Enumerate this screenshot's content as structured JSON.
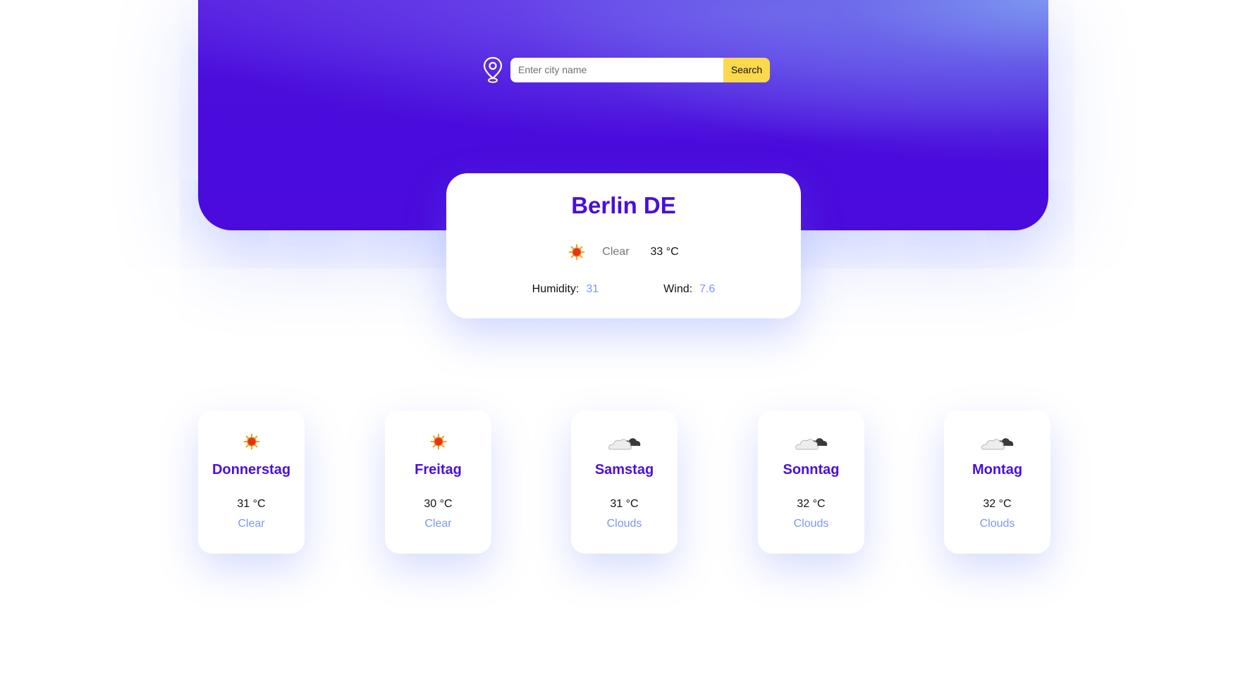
{
  "search": {
    "placeholder": "Enter city name",
    "button_label": "Search",
    "icon": "location-pin-icon"
  },
  "current": {
    "city": "Berlin DE",
    "icon": "sun-icon",
    "condition": "Clear",
    "temperature": "33 °C",
    "humidity_label": "Humidity:",
    "humidity_value": "31",
    "wind_label": "Wind:",
    "wind_value": "7.6"
  },
  "forecast": [
    {
      "day": "Donnerstag",
      "temperature": "31 °C",
      "condition": "Clear",
      "icon": "sun-icon"
    },
    {
      "day": "Freitag",
      "temperature": "30 °C",
      "condition": "Clear",
      "icon": "sun-icon"
    },
    {
      "day": "Samstag",
      "temperature": "31 °C",
      "condition": "Clouds",
      "icon": "cloud-icon"
    },
    {
      "day": "Sonntag",
      "temperature": "32 °C",
      "condition": "Clouds",
      "icon": "cloud-icon"
    },
    {
      "day": "Montag",
      "temperature": "32 °C",
      "condition": "Clouds",
      "icon": "cloud-icon"
    }
  ],
  "colors": {
    "primary": "#4a0edc",
    "accent": "#fad94d",
    "value_blue": "#7d96f2",
    "hero_light": "#7d9bf0"
  }
}
